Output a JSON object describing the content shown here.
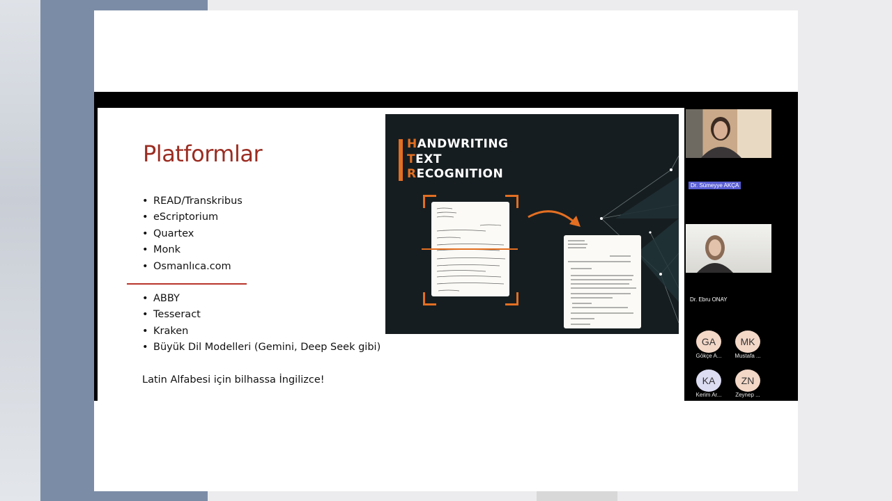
{
  "slide": {
    "title": "Platformlar",
    "group1": [
      "READ/Transkribus",
      "eScriptorium",
      "Quartex",
      "Monk",
      "Osmanlıca.com"
    ],
    "group2": [
      "ABBY",
      "Tesseract",
      "Kraken",
      "Büyük Dil Modelleri (Gemini, Deep Seek gibi)"
    ],
    "note": "Latin Alfabesi için bilhassa İngilizce!"
  },
  "htr_image": {
    "line1_first": "H",
    "line1_rest": "ANDWRITING",
    "line2_first": "T",
    "line2_rest": "EXT",
    "line3_first": "R",
    "line3_rest": "ECOGNITION",
    "accent_color": "#e36f22"
  },
  "participants": {
    "speaker1": "Dr. Sümeyye  AKÇA",
    "speaker2": "Dr. Ebru ONAY",
    "attendees": [
      {
        "initials": "GA",
        "name": "Gökçe A...",
        "color": "#f3d7c7"
      },
      {
        "initials": "MK",
        "name": "Mustafa ...",
        "color": "#f3d7c7"
      },
      {
        "initials": "KA",
        "name": "Kerim Ar...",
        "color": "#dcdcf3"
      },
      {
        "initials": "ZN",
        "name": "Zeynep ...",
        "color": "#f3d7c7"
      }
    ]
  }
}
